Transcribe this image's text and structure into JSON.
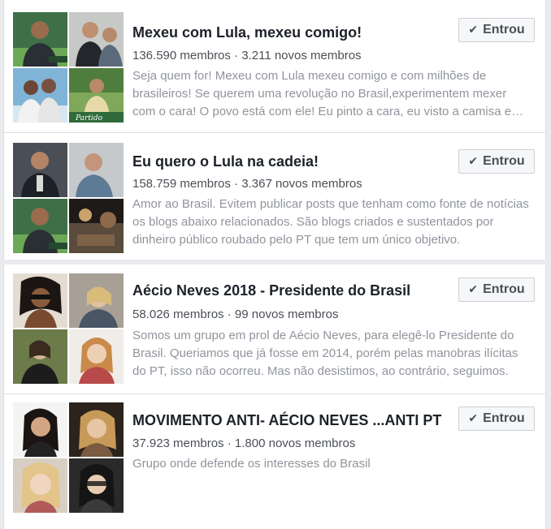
{
  "groups": [
    {
      "title": "Mexeu com Lula, mexeu comigo!",
      "members": "136.590 membros",
      "dot": "·",
      "new_members": "3.211 novos membros",
      "description": "Seja quem for! Mexeu com Lula mexeu comigo e com milhões de brasileiros! Se querem uma revolução no Brasil,experimentem mexer com o cara! O povo está com ele! Eu pinto a cara, eu visto a camisa e vou pra rua!",
      "button_label": "Entrou",
      "thumb_captions": [
        "",
        "",
        "",
        "Partido"
      ]
    },
    {
      "title": "Eu quero o Lula na cadeia!",
      "members": "158.759 membros",
      "dot": "·",
      "new_members": "3.367 novos membros",
      "description": "Amor ao Brasil. Evitem publicar posts que tenham como fonte de notícias os blogs abaixo relacionados. São blogs criados e sustentados por dinheiro público roubado pelo PT que tem um único objetivo.",
      "button_label": "Entrou",
      "thumb_captions": [
        "",
        "",
        "",
        ""
      ]
    },
    {
      "title": "Aécio Neves 2018 - Presidente do Brasil",
      "members": "58.026 membros",
      "dot": "·",
      "new_members": "99 novos membros",
      "description": "Somos um grupo em prol de Aécio Neves, para elegê-lo Presidente do Brasil. Queriamos que já fosse em 2014, porém pelas manobras ilícitas do PT, isso não ocorreu. Mas não desistimos, ao contrário, seguimos.",
      "button_label": "Entrou",
      "thumb_captions": [
        "",
        "",
        "",
        ""
      ]
    },
    {
      "title": "MOVIMENTO ANTI- AÉCIO NEVES ...ANTI PT",
      "members": "37.923 membros",
      "dot": "·",
      "new_members": "1.800 novos membros",
      "description": "Grupo onde defende os interesses do Brasil",
      "button_label": "Entrou",
      "thumb_captions": [
        "",
        "",
        "",
        ""
      ]
    }
  ],
  "icons": {
    "check": "✔"
  },
  "colors": {
    "page_bg": "#e9ebee",
    "title": "#1d2129",
    "stats": "#4b4f56",
    "description": "#90949c",
    "button_bg": "#f6f7f9",
    "button_border": "#ced0d4"
  }
}
